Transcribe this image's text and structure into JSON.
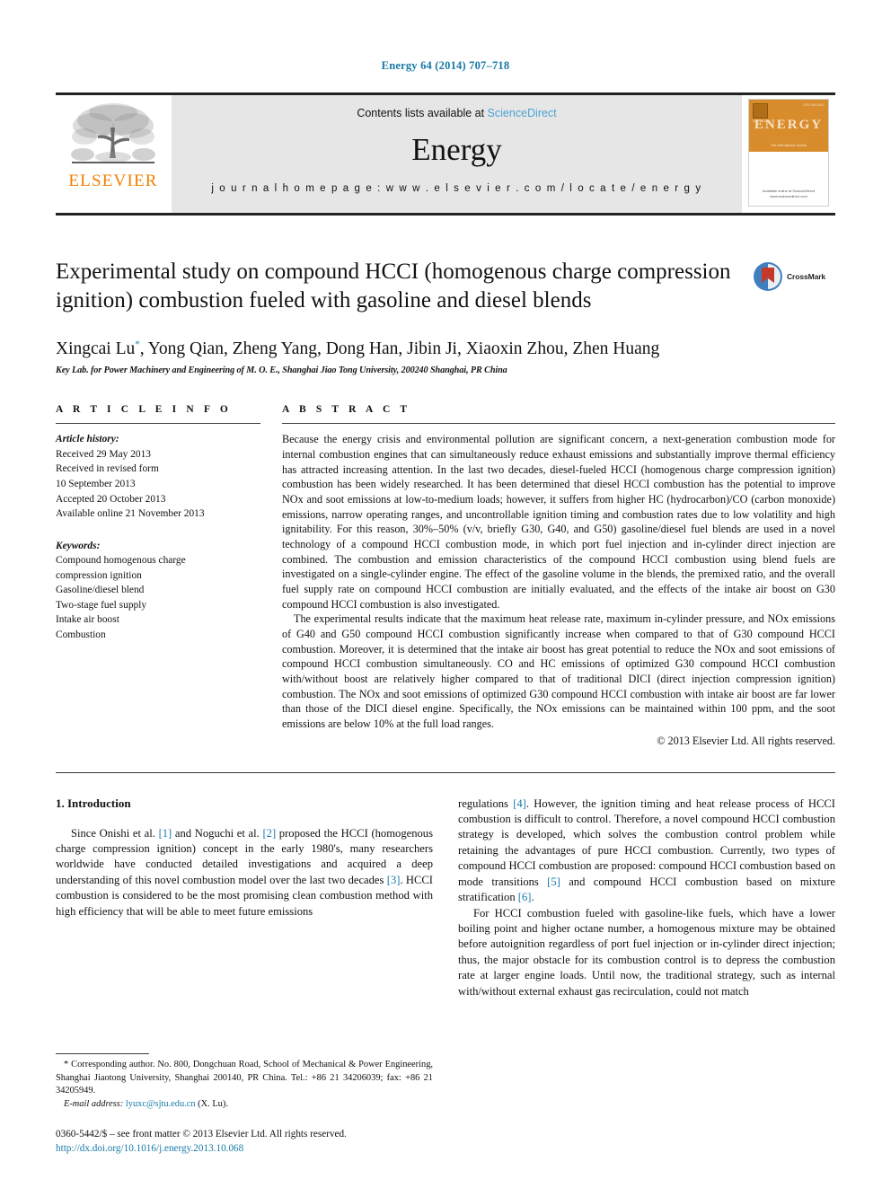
{
  "running_head": "Energy 64 (2014) 707–718",
  "masthead": {
    "publisher_name": "ELSEVIER",
    "contents_prefix": "Contents lists available at ",
    "contents_link": "ScienceDirect",
    "journal_name": "Energy",
    "homepage": "j o u r n a l   h o m e p a g e :   w w w . e l s e v i e r . c o m / l o c a t e / e n e r g y",
    "cover": {
      "title": "ENERGY",
      "subtitle": "The International Journal",
      "top_left_note": "ScienceDirect",
      "top_right_note": "ISSN 0360-5442",
      "footer_note": "Available online at\nScienceDirect\nwww.sciencedirect.com"
    }
  },
  "article": {
    "title": "Experimental study on compound HCCI (homogenous charge compression ignition) combustion fueled with gasoline and diesel blends",
    "crossmark_label": "CrossMark",
    "authors": "Xingcai Lu",
    "authors_marker": "*",
    "authors_rest": ", Yong Qian, Zheng Yang, Dong Han, Jibin Ji, Xiaoxin Zhou, Zhen Huang",
    "affiliation": "Key Lab. for Power Machinery and Engineering of M. O. E., Shanghai Jiao Tong University, 200240 Shanghai, PR China"
  },
  "article_info": {
    "heading": "A R T I C L E   I N F O",
    "history_label": "Article history:",
    "history": [
      "Received 29 May 2013",
      "Received in revised form",
      "10 September 2013",
      "Accepted 20 October 2013",
      "Available online 21 November 2013"
    ],
    "keywords_label": "Keywords:",
    "keywords": [
      "Compound homogenous charge",
      "compression ignition",
      "Gasoline/diesel blend",
      "Two-stage fuel supply",
      "Intake air boost",
      "Combustion"
    ]
  },
  "abstract": {
    "heading": "A B S T R A C T",
    "paragraph_1": "Because the energy crisis and environmental pollution are significant concern, a next-generation combustion mode for internal combustion engines that can simultaneously reduce exhaust emissions and substantially improve thermal efficiency has attracted increasing attention. In the last two decades, diesel-fueled HCCI (homogenous charge compression ignition) combustion has been widely researched. It has been determined that diesel HCCI combustion has the potential to improve NOx and soot emissions at low-to-medium loads; however, it suffers from higher HC (hydrocarbon)/CO (carbon monoxide) emissions, narrow operating ranges, and uncontrollable ignition timing and combustion rates due to low volatility and high ignitability. For this reason, 30%–50% (v/v, briefly G30, G40, and G50) gasoline/diesel fuel blends are used in a novel technology of a compound HCCI combustion mode, in which port fuel injection and in-cylinder direct injection are combined. The combustion and emission characteristics of the compound HCCI combustion using blend fuels are investigated on a single-cylinder engine. The effect of the gasoline volume in the blends, the premixed ratio, and the overall fuel supply rate on compound HCCI combustion are initially evaluated, and the effects of the intake air boost on G30 compound HCCI combustion is also investigated.",
    "paragraph_2": "The experimental results indicate that the maximum heat release rate, maximum in-cylinder pressure, and NOx emissions of G40 and G50 compound HCCI combustion significantly increase when compared to that of G30 compound HCCI combustion. Moreover, it is determined that the intake air boost has great potential to reduce the NOx and soot emissions of compound HCCI combustion simultaneously. CO and HC emissions of optimized G30 compound HCCI combustion with/without boost are relatively higher compared to that of traditional DICI (direct injection compression ignition) combustion. The NOx and soot emissions of optimized G30 compound HCCI combustion with intake air boost are far lower than those of the DICI diesel engine. Specifically, the NOx emissions can be maintained within 100 ppm, and the soot emissions are below 10% at the full load ranges.",
    "copyright": "© 2013 Elsevier Ltd. All rights reserved."
  },
  "introduction": {
    "section_title": "1. Introduction",
    "left_p1_a": "Since Onishi et al. ",
    "left_p1_r1": "[1]",
    "left_p1_b": " and Noguchi et al. ",
    "left_p1_r2": "[2]",
    "left_p1_c": " proposed the HCCI (homogenous charge compression ignition) concept in the early 1980's, many researchers worldwide have conducted detailed investigations and acquired a deep understanding of this novel combustion model over the last two decades ",
    "left_p1_r3": "[3]",
    "left_p1_d": ". HCCI combustion is considered to be the most promising clean combustion method with high efficiency that will be able to meet future emissions",
    "right_p1_a": "regulations ",
    "right_p1_r1": "[4]",
    "right_p1_b": ". However, the ignition timing and heat release process of HCCI combustion is difficult to control. Therefore, a novel compound HCCI combustion strategy is developed, which solves the combustion control problem while retaining the advantages of pure HCCI combustion. Currently, two types of compound HCCI combustion are proposed: compound HCCI combustion based on mode transitions ",
    "right_p1_r2": "[5]",
    "right_p1_c": " and compound HCCI combustion based on mixture stratification ",
    "right_p1_r3": "[6]",
    "right_p1_d": ".",
    "right_p2": "For HCCI combustion fueled with gasoline-like fuels, which have a lower boiling point and higher octane number, a homogenous mixture may be obtained before autoignition regardless of port fuel injection or in-cylinder direct injection; thus, the major obstacle for its combustion control is to depress the combustion rate at larger engine loads. Until now, the traditional strategy, such as internal with/without external exhaust gas recirculation, could not match"
  },
  "footnotes": {
    "corresponding": "* Corresponding author. No. 800, Dongchuan Road, School of Mechanical & Power Engineering, Shanghai Jiaotong University, Shanghai 200140, PR China. Tel.: +86 21 34206039; fax: +86 21 34205949.",
    "email_label": "E-mail address:",
    "email": "lyuxc@sjtu.edu.cn",
    "email_suffix": "(X. Lu).",
    "imprint": "0360-5442/$ – see front matter © 2013 Elsevier Ltd. All rights reserved.",
    "doi": "http://dx.doi.org/10.1016/j.energy.2013.10.068"
  },
  "colors": {
    "link": "#1879a8",
    "sciencedirect": "#4ba3d3",
    "elsevier_orange": "#f08000",
    "cover_orange": "#d98c2b",
    "crossmark_red": "#c4392a",
    "crossmark_blue": "#3f7fbf"
  }
}
